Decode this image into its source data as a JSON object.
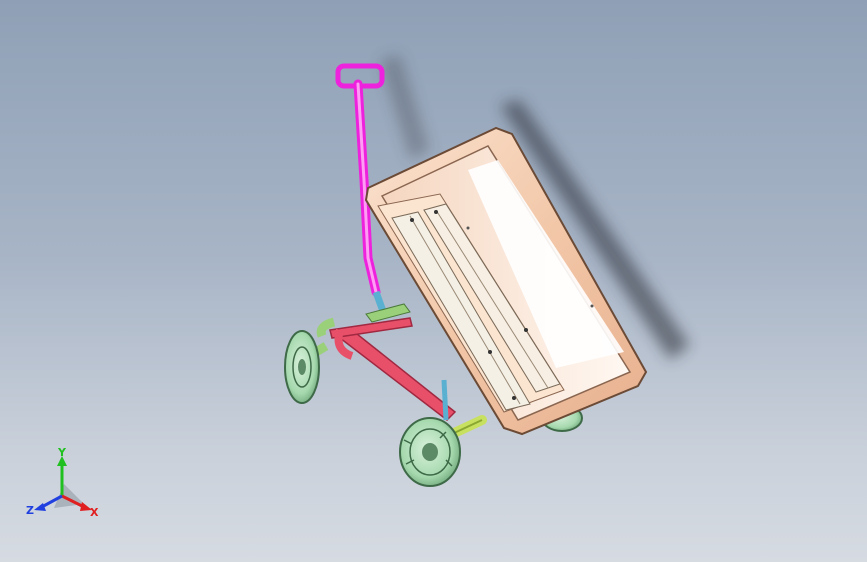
{
  "viewport": {
    "background_top": "#8fa0b6",
    "background_bottom": "#d6dbe2"
  },
  "model": {
    "tray_color": "#f6d2b8",
    "handle_color": "#ee22dd",
    "frame_color": "#e8506a",
    "wheel_color": "#a9dcb0",
    "axle_color": "#c8e060",
    "strut_color": "#5ab0d0"
  },
  "triad": {
    "x_label": "X",
    "y_label": "Y",
    "z_label": "Z",
    "x_color": "#e02020",
    "y_color": "#20c020",
    "z_color": "#2040e0"
  }
}
